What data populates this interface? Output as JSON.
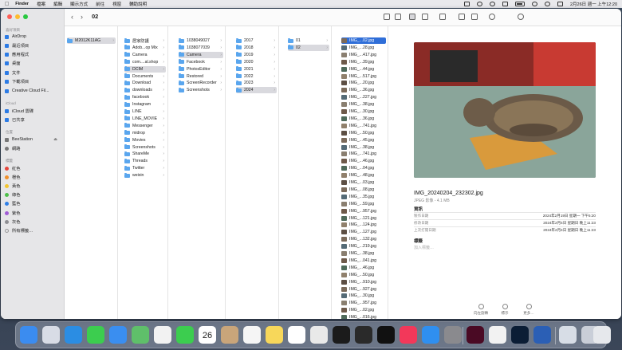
{
  "menubar": {
    "apple": "",
    "items": [
      "Finder",
      "檔案",
      "編輯",
      "顯示方式",
      "前往",
      "視窗",
      "輔助說明"
    ],
    "datetime": "2月26日 週一 上午12:20"
  },
  "toolbar": {
    "title": "02",
    "back": "‹",
    "forward": "›"
  },
  "sidebar": {
    "favorites_head": "喜好項目",
    "favorites": [
      {
        "label": "AirDrop",
        "icon": "airdrop-icon"
      },
      {
        "label": "最近項目",
        "icon": "clock-icon"
      },
      {
        "label": "應用程式",
        "icon": "apps-icon"
      },
      {
        "label": "桌面",
        "icon": "desktop-icon"
      },
      {
        "label": "文件",
        "icon": "document-icon"
      },
      {
        "label": "下載項目",
        "icon": "download-icon"
      },
      {
        "label": "Creative Cloud Fil...",
        "icon": "cloud-icon"
      }
    ],
    "icloud_head": "iCloud",
    "icloud": [
      {
        "label": "iCloud 雲碟",
        "icon": "icloud-icon"
      },
      {
        "label": "已共享",
        "icon": "shared-folder-icon"
      }
    ],
    "locations_head": "位置",
    "locations": [
      {
        "label": "BeeStation",
        "icon": "server-icon"
      },
      {
        "label": "網路",
        "icon": "network-icon"
      }
    ],
    "tags_head": "標籤",
    "tags": [
      {
        "label": "紅色",
        "color": "#e6453c"
      },
      {
        "label": "橙色",
        "color": "#f0902b"
      },
      {
        "label": "黃色",
        "color": "#f2c531"
      },
      {
        "label": "綠色",
        "color": "#4dbf4a"
      },
      {
        "label": "藍色",
        "color": "#2f7fe6"
      },
      {
        "label": "紫色",
        "color": "#a05cd6"
      },
      {
        "label": "灰色",
        "color": "#8e8e93"
      },
      {
        "label": "所有標籤…",
        "color": ""
      }
    ]
  },
  "columns": {
    "col1": [
      "M2012K11AG"
    ],
    "col2": [
      "居家防護",
      "Adob...op Mix",
      "Camera",
      "com....al.shop",
      "DCIM",
      "Documents",
      "Download",
      "downloads",
      "facebook",
      "Instagram",
      "LINE",
      "LINE_MOVIE",
      "Messenger",
      "midrop",
      "Movies",
      "Screenshots",
      "ShareMe",
      "Threads",
      "Twitter",
      "weixin"
    ],
    "col3": [
      "1038049027",
      "1038077039",
      "Camera",
      "Facebook",
      "PhotosEditor",
      "Restored",
      "ScreenRecorder",
      "Screenshots"
    ],
    "col4": [
      "2017",
      "2018",
      "2019",
      "2020",
      "2021",
      "2022",
      "2023",
      "2024"
    ],
    "col5": [
      "01",
      "02"
    ],
    "col6": [
      "IMG_...02.jpg",
      "IMG_...28.jpg",
      "IMG_...417.jpg",
      "IMG_...39.jpg",
      "IMG_...44.jpg",
      "IMG_...517.jpg",
      "IMG_...20.jpg",
      "IMG_...36.jpg",
      "IMG_...227.jpg",
      "IMG_...38.jpg",
      "IMG_...30.jpg",
      "IMG_...36.jpg",
      "IMG_...741.jpg",
      "IMG_...50.jpg",
      "IMG_...45.jpg",
      "IMG_...38.jpg",
      "IMG_...741.jpg",
      "IMG_...46.jpg",
      "IMG_...04.jpg",
      "IMG_...48.jpg",
      "IMG_...03.jpg",
      "IMG_...08.jpg",
      "IMG_...35.jpg",
      "IMG_...59.jpg",
      "IMG_...957.jpg",
      "IMG_...121.jpg",
      "IMG_...124.jpg",
      "IMG_...127.jpg",
      "IMG_...132.jpg",
      "IMG_...219.jpg",
      "IMG_...38.jpg",
      "IMG_...041.jpg",
      "IMG_...46.jpg",
      "IMG_...50.jpg",
      "IMG_...910.jpg",
      "IMG_...927.jpg",
      "IMG_...30.jpg",
      "IMG_...957.jpg",
      "IMG_...02.jpg",
      "IMG_...016.jpg"
    ]
  },
  "preview": {
    "filename": "IMG_20240204_232302.jpg",
    "meta": "JPEG 影像 - 4.1 MB",
    "info_head": "資訊",
    "info": [
      {
        "key": "製作日期",
        "value": "2024年2月19日 星期一 下午5:20"
      },
      {
        "key": "修改日期",
        "value": "2024年2月4日 星期日 晚上11:23"
      },
      {
        "key": "上次打開日期",
        "value": "2024年2月4日 星期日 晚上11:23"
      }
    ],
    "tags_head": "標籤",
    "tags_placeholder": "加入標籤…",
    "actions": [
      "向左旋轉",
      "標示",
      "更多…"
    ]
  },
  "dock": {
    "apps": [
      {
        "name": "finder",
        "color": "#3b8cf0"
      },
      {
        "name": "launchpad",
        "color": "#d8dce6"
      },
      {
        "name": "safari",
        "color": "#2b8de3"
      },
      {
        "name": "messages",
        "color": "#3ccd4f"
      },
      {
        "name": "mail",
        "color": "#3a8ef0"
      },
      {
        "name": "maps",
        "color": "#5fbf6a"
      },
      {
        "name": "photos",
        "color": "#f2f2f2"
      },
      {
        "name": "facetime",
        "color": "#3ccd4f"
      },
      {
        "name": "calendar",
        "color": "#ffffff"
      },
      {
        "name": "contacts",
        "color": "#c9a57a"
      },
      {
        "name": "reminders",
        "color": "#f5f5f5"
      },
      {
        "name": "notes",
        "color": "#f7d75a"
      },
      {
        "name": "freeform",
        "color": "#ffffff"
      },
      {
        "name": "chrome",
        "color": "#e9e9e9"
      },
      {
        "name": "capcut",
        "color": "#1b1b1b"
      },
      {
        "name": "iphone-mirroring",
        "color": "#2a2a2a"
      },
      {
        "name": "apple-tv",
        "color": "#111111"
      },
      {
        "name": "music",
        "color": "#f2385a"
      },
      {
        "name": "app-store",
        "color": "#2f8ff0"
      },
      {
        "name": "system-settings",
        "color": "#8a8a8e"
      },
      {
        "name": "indesign",
        "color": "#4a0a24"
      },
      {
        "name": "pages",
        "color": "#f2f2f2"
      },
      {
        "name": "photoshop",
        "color": "#0b1d35"
      },
      {
        "name": "word",
        "color": "#2b5fb5"
      },
      {
        "name": "preview-app",
        "color": "#d7dde6"
      },
      {
        "name": "downloads-stack",
        "color": "#c9ced8"
      },
      {
        "name": "trash",
        "color": "#e6e8ec"
      }
    ],
    "calendar_day": "26"
  }
}
